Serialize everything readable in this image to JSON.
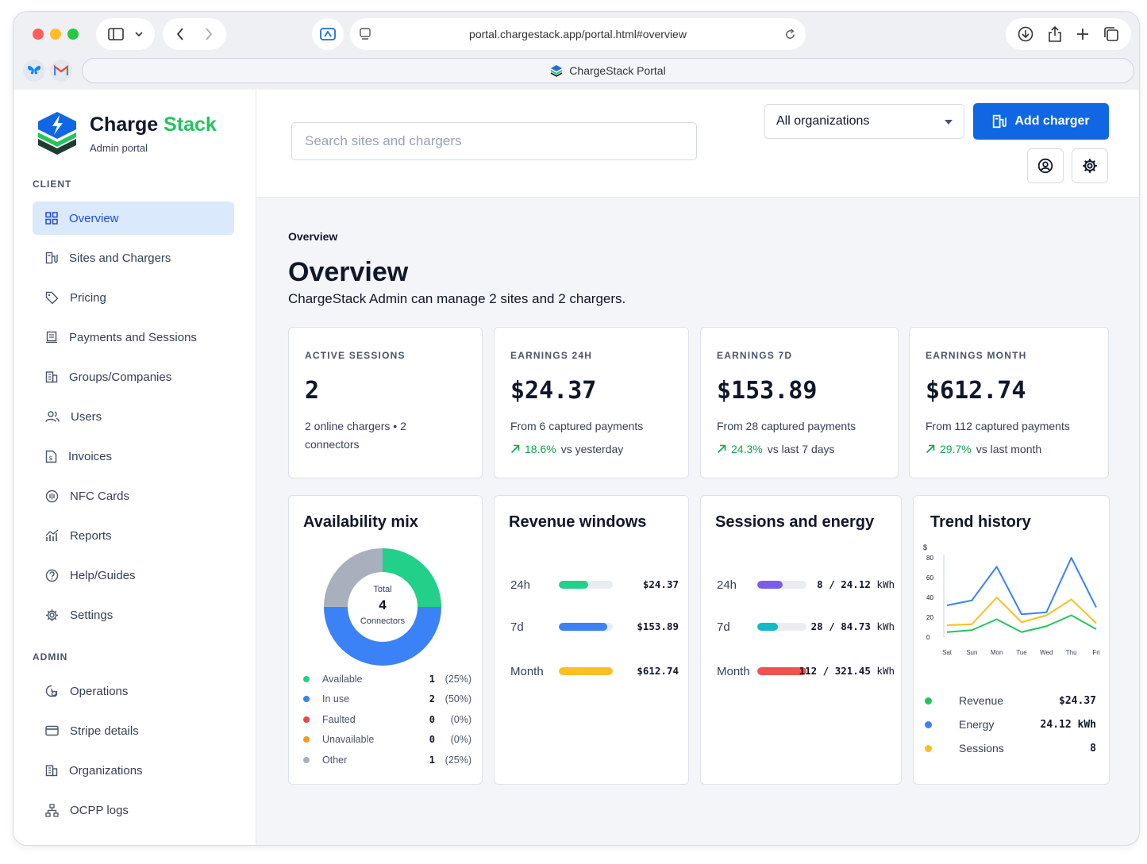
{
  "browser": {
    "url": "portal.chargestack.app/portal.html#overview",
    "tab_title": "ChargeStack Portal"
  },
  "brand": {
    "name_part1": "Charge",
    "name_part2": "Stack",
    "subtitle": "Admin portal"
  },
  "sidebar": {
    "client_label": "CLIENT",
    "client_items": [
      {
        "label": "Overview",
        "icon": "grid-icon",
        "active": true
      },
      {
        "label": "Sites and Chargers",
        "icon": "charger-icon"
      },
      {
        "label": "Pricing",
        "icon": "tag-icon"
      },
      {
        "label": "Payments and Sessions",
        "icon": "receipt-icon"
      },
      {
        "label": "Groups/Companies",
        "icon": "building-icon"
      },
      {
        "label": "Users",
        "icon": "users-icon"
      },
      {
        "label": "Invoices",
        "icon": "invoice-icon"
      },
      {
        "label": "NFC Cards",
        "icon": "nfc-icon"
      },
      {
        "label": "Reports",
        "icon": "chart-icon"
      },
      {
        "label": "Help/Guides",
        "icon": "help-icon"
      },
      {
        "label": "Settings",
        "icon": "gear-icon"
      }
    ],
    "admin_label": "ADMIN",
    "admin_items": [
      {
        "label": "Operations",
        "icon": "operations-icon"
      },
      {
        "label": "Stripe details",
        "icon": "card-icon"
      },
      {
        "label": "Organizations",
        "icon": "organizations-icon"
      },
      {
        "label": "OCPP logs",
        "icon": "logs-icon"
      }
    ]
  },
  "topbar": {
    "search_placeholder": "Search sites and chargers",
    "org_select": "All organizations",
    "add_button": "Add charger"
  },
  "page": {
    "breadcrumb": "Overview",
    "title": "Overview",
    "subtitle": "ChargeStack Admin can manage 2 sites and 2 chargers."
  },
  "stats": [
    {
      "label": "ACTIVE SESSIONS",
      "value": "2",
      "desc": "2 online chargers • 2 connectors",
      "trend_pct": "",
      "trend_text": ""
    },
    {
      "label": "EARNINGS 24H",
      "value": "$24.37",
      "desc": "From 6 captured payments",
      "trend_pct": "18.6%",
      "trend_text": "vs yesterday"
    },
    {
      "label": "EARNINGS 7D",
      "value": "$153.89",
      "desc": "From 28 captured payments",
      "trend_pct": "24.3%",
      "trend_text": "vs last 7 days"
    },
    {
      "label": "EARNINGS MONTH",
      "value": "$612.74",
      "desc": "From 112 captured payments",
      "trend_pct": "29.7%",
      "trend_text": "vs last month"
    }
  ],
  "availability": {
    "title": "Availability mix",
    "center_top": "Total",
    "center_value": "4",
    "center_bottom": "Connectors",
    "items": [
      {
        "name": "Available",
        "value": 1,
        "pct": "(25%)",
        "color": "#22d08a"
      },
      {
        "name": "In use",
        "value": 2,
        "pct": "(50%)",
        "color": "#3b82f6"
      },
      {
        "name": "Faulted",
        "value": 0,
        "pct": "(0%)",
        "color": "#ef4444"
      },
      {
        "name": "Unavailable",
        "value": 0,
        "pct": "(0%)",
        "color": "#f59e0b"
      },
      {
        "name": "Other",
        "value": 1,
        "pct": "(25%)",
        "color": "#a8b0bd"
      }
    ]
  },
  "revenue": {
    "title": "Revenue windows",
    "rows": [
      {
        "label": "24h",
        "value": "$24.37",
        "fill": 0.55,
        "color": "#22d08a"
      },
      {
        "label": "7d",
        "value": "$153.89",
        "fill": 0.9,
        "color": "#3b82f6"
      },
      {
        "label": "Month",
        "value": "$612.74",
        "fill": 1.0,
        "color": "#fbbf24"
      }
    ]
  },
  "sessions": {
    "title": "Sessions and energy",
    "rows": [
      {
        "label": "24h",
        "count": "8",
        "energy": "24.12",
        "unit": "kWh",
        "fill": 0.52,
        "color": "#7c5cf0"
      },
      {
        "label": "7d",
        "count": "28",
        "energy": "84.73",
        "unit": "kWh",
        "fill": 0.42,
        "color": "#14b8c8"
      },
      {
        "label": "Month",
        "count": "112",
        "energy": "321.45",
        "unit": "kWh",
        "fill": 1.0,
        "color": "#f05252"
      }
    ]
  },
  "trend": {
    "title": "Trend history",
    "legend": [
      {
        "name": "Revenue",
        "value": "$24.37",
        "color": "#22c55e"
      },
      {
        "name": "Energy",
        "value": "24.12 kWh",
        "color": "#3b82f6"
      },
      {
        "name": "Sessions",
        "value": "8",
        "color": "#fbbf24"
      }
    ]
  },
  "chart_data": {
    "type": "line",
    "title": "Trend history",
    "ylabel": "$",
    "categories": [
      "Sat",
      "Sun",
      "Mon",
      "Tue",
      "Wed",
      "Thu",
      "Fri"
    ],
    "yticks": [
      0,
      20,
      40,
      60,
      80
    ],
    "ylim": [
      0,
      80
    ],
    "series": [
      {
        "name": "Energy",
        "color": "#3b82f6",
        "values": [
          32,
          37,
          71,
          23,
          25,
          80,
          30
        ]
      },
      {
        "name": "Sessions",
        "color": "#fbbf24",
        "values": [
          12,
          13,
          40,
          15,
          22,
          38,
          14
        ]
      },
      {
        "name": "Revenue",
        "color": "#22c55e",
        "values": [
          5,
          7,
          18,
          5,
          11,
          22,
          8
        ]
      }
    ],
    "grid": false,
    "legend": "bottom"
  }
}
